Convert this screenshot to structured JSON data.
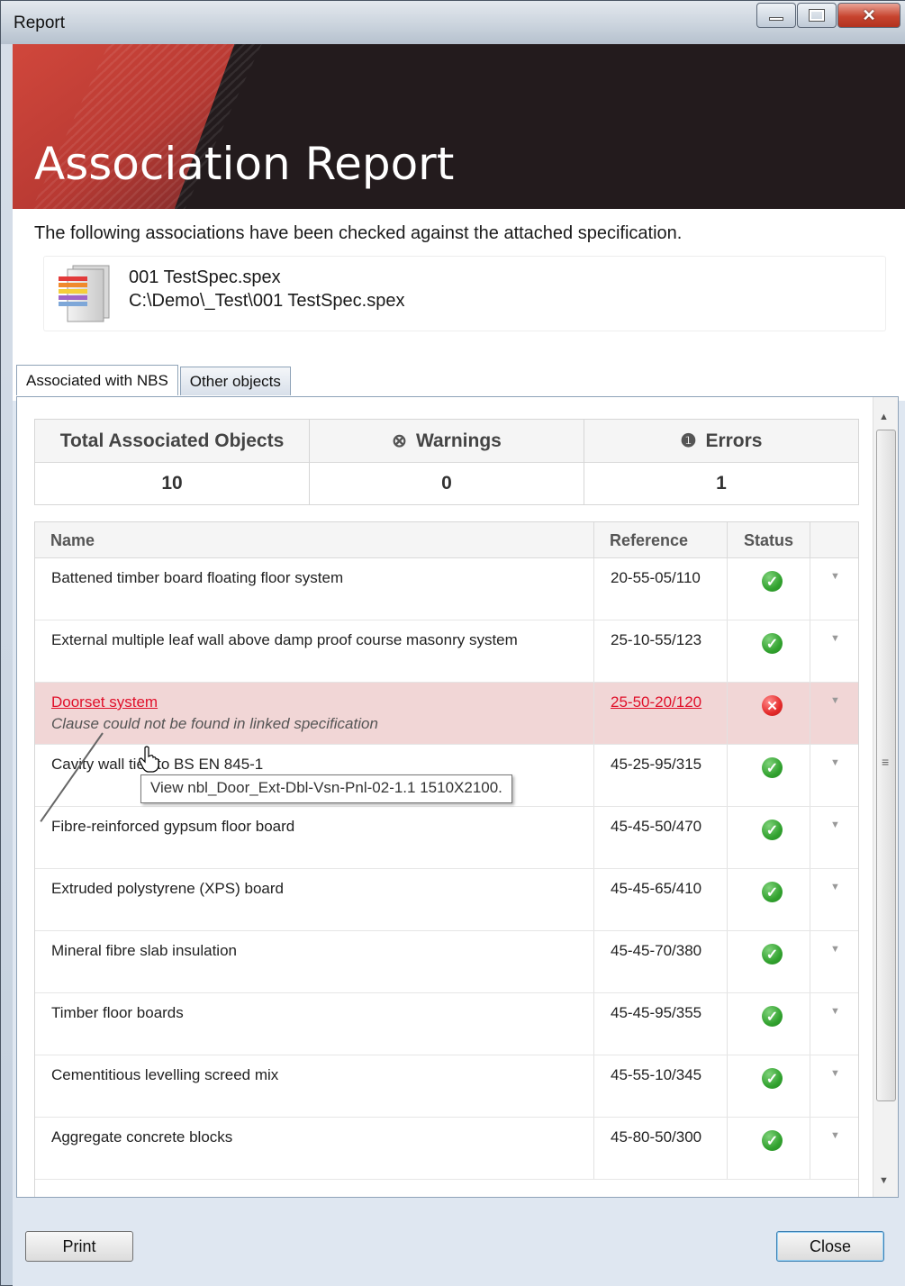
{
  "window": {
    "title": "Report"
  },
  "header": {
    "title": "Association Report"
  },
  "intro_text": "The following associations have been checked against the attached specification.",
  "file": {
    "name": "001 TestSpec.spex",
    "path": "C:\\Demo\\_Test\\001 TestSpec.spex"
  },
  "tabs": [
    {
      "label": "Associated with NBS",
      "active": true
    },
    {
      "label": "Other objects",
      "active": false
    }
  ],
  "summary": {
    "total_label": "Total Associated Objects",
    "total_value": "10",
    "warnings_label": "Warnings",
    "warnings_value": "0",
    "errors_label": "Errors",
    "errors_value": "1"
  },
  "table": {
    "columns": [
      "Name",
      "Reference",
      "Status"
    ],
    "rows": [
      {
        "name": "Battened timber board floating floor system",
        "reference": "20-55-05/110",
        "status": "ok"
      },
      {
        "name": "External multiple leaf wall above damp proof course masonry system",
        "reference": "25-10-55/123",
        "status": "ok"
      },
      {
        "name": "Doorset system",
        "reference": "25-50-20/120",
        "status": "error",
        "note": "Clause could not be found in linked specification"
      },
      {
        "name": "Cavity wall ties to BS EN 845-1",
        "reference": "45-25-95/315",
        "status": "ok"
      },
      {
        "name": "Fibre-reinforced gypsum floor board",
        "reference": "45-45-50/470",
        "status": "ok"
      },
      {
        "name": "Extruded polystyrene (XPS) board",
        "reference": "45-45-65/410",
        "status": "ok"
      },
      {
        "name": "Mineral fibre slab insulation",
        "reference": "45-45-70/380",
        "status": "ok"
      },
      {
        "name": "Timber floor boards",
        "reference": "45-45-95/355",
        "status": "ok"
      },
      {
        "name": "Cementitious levelling screed mix",
        "reference": "45-55-10/345",
        "status": "ok"
      },
      {
        "name": "Aggregate concrete blocks",
        "reference": "45-80-50/300",
        "status": "ok"
      }
    ]
  },
  "tooltip": "View nbl_Door_Ext-Dbl-Vsn-Pnl-02-1.1 1510X2100.",
  "buttons": {
    "print": "Print",
    "close": "Close"
  },
  "colors": {
    "error_row": "#f1d6d6",
    "error_text": "#e0102a",
    "ok": "#32a22f",
    "banner": "#231b1d",
    "accent_red": "#c7412f"
  }
}
